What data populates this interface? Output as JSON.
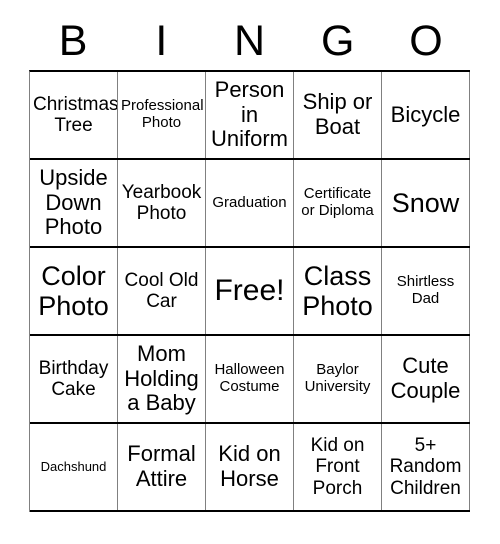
{
  "card": {
    "header": {
      "letters": [
        "B",
        "I",
        "N",
        "G",
        "O"
      ]
    },
    "grid": {
      "columns": 5,
      "rows": 5,
      "free_space": {
        "row": 3,
        "column": 3,
        "label": "Free!"
      },
      "cells": [
        [
          {
            "label": "Christmas Tree",
            "size": "md"
          },
          {
            "label": "Professional Photo",
            "size": "sm"
          },
          {
            "label": "Person in Uniform",
            "size": "lg"
          },
          {
            "label": "Ship or Boat",
            "size": "lg"
          },
          {
            "label": "Bicycle",
            "size": "lg"
          }
        ],
        [
          {
            "label": "Upside Down Photo",
            "size": "lg"
          },
          {
            "label": "Yearbook Photo",
            "size": "md"
          },
          {
            "label": "Graduation",
            "size": "sm"
          },
          {
            "label": "Certificate or Diploma",
            "size": "sm"
          },
          {
            "label": "Snow",
            "size": "xl"
          }
        ],
        [
          {
            "label": "Color Photo",
            "size": "xl"
          },
          {
            "label": "Cool Old Car",
            "size": "md"
          },
          {
            "label": "Free!",
            "size": "free"
          },
          {
            "label": "Class Photo",
            "size": "xl"
          },
          {
            "label": "Shirtless Dad",
            "size": "sm"
          }
        ],
        [
          {
            "label": "Birthday Cake",
            "size": "md"
          },
          {
            "label": "Mom Holding a Baby",
            "size": "lg"
          },
          {
            "label": "Halloween Costume",
            "size": "sm"
          },
          {
            "label": "Baylor University",
            "size": "sm"
          },
          {
            "label": "Cute Couple",
            "size": "lg"
          }
        ],
        [
          {
            "label": "Dachshund",
            "size": "xs"
          },
          {
            "label": "Formal Attire",
            "size": "lg"
          },
          {
            "label": "Kid on Horse",
            "size": "lg"
          },
          {
            "label": "Kid on Front Porch",
            "size": "md"
          },
          {
            "label": "5+ Random Children",
            "size": "md"
          }
        ]
      ]
    },
    "colors": {
      "text": "#000000",
      "background": "#ffffff",
      "row_border": "#000000",
      "column_border": "#808080"
    }
  }
}
